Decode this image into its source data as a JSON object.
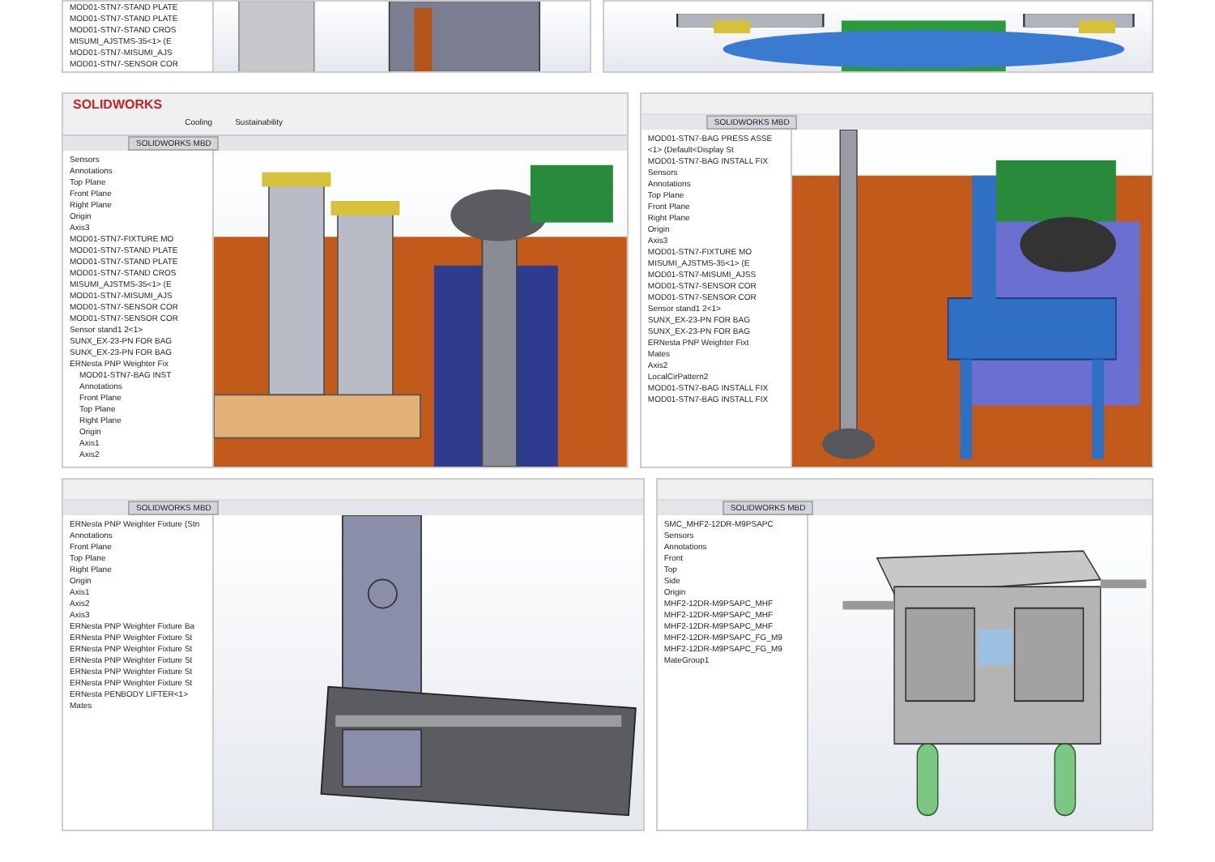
{
  "rows": [
    {
      "panels": [
        {
          "tree": [
            {
              "label": "MOD01-STN7-STAND PLATE"
            },
            {
              "label": "MOD01-STN7-STAND PLATE"
            },
            {
              "label": "MOD01-STN7-STAND CROS"
            },
            {
              "label": "MISUMI_AJSTMS-35<1> (E"
            },
            {
              "label": "MOD01-STN7-MISUMI_AJS"
            },
            {
              "label": "MOD01-STN7-SENSOR COR"
            }
          ],
          "viewport": {
            "kind": "gray"
          }
        },
        {
          "viewport": {
            "kind": "radial"
          }
        }
      ]
    },
    {
      "panels": [
        {
          "toolbar": {
            "logo": "SOLIDWORKS",
            "tools": [
              "Cooling",
              "Sustainability"
            ]
          },
          "tabs": [
            "SOLIDWORKS MBD"
          ],
          "tree": [
            {
              "label": "Sensors"
            },
            {
              "label": "Annotations"
            },
            {
              "label": "Top Plane"
            },
            {
              "label": "Front Plane"
            },
            {
              "label": "Right Plane"
            },
            {
              "label": "Origin"
            },
            {
              "label": "Axis3"
            },
            {
              "label": "MOD01-STN7-FIXTURE MO"
            },
            {
              "label": "MOD01-STN7-STAND PLATE"
            },
            {
              "label": "MOD01-STN7-STAND PLATE"
            },
            {
              "label": "MOD01-STN7-STAND CROS"
            },
            {
              "label": "MISUMI_AJSTMS-35<1> (E"
            },
            {
              "label": "MOD01-STN7-MISUMI_AJS"
            },
            {
              "label": "MOD01-STN7-SENSOR COR"
            },
            {
              "label": "MOD01-STN7-SENSOR COR"
            },
            {
              "label": "Sensor stand1 2<1>"
            },
            {
              "label": "SUNX_EX-23-PN FOR BAG"
            },
            {
              "label": "SUNX_EX-23-PN FOR BAG"
            },
            {
              "label": "ERNesta PNP Weighter Fix",
              "children": [
                {
                  "label": "MOD01-STN7-BAG INST"
                },
                {
                  "label": "Annotations"
                },
                {
                  "label": "Front Plane"
                },
                {
                  "label": "Top Plane"
                },
                {
                  "label": "Right Plane"
                },
                {
                  "label": "Origin"
                },
                {
                  "label": "Axis1"
                },
                {
                  "label": "Axis2"
                }
              ]
            }
          ],
          "viewport": {
            "kind": "orange"
          }
        },
        {
          "tabs": [
            "SOLIDWORKS MBD"
          ],
          "tree": [
            {
              "label": "MOD01-STN7-BAG PRESS ASSE"
            },
            {
              "label": "<1> (Default<Display St"
            },
            {
              "label": "MOD01-STN7-BAG INSTALL FIX"
            },
            {
              "label": "Sensors"
            },
            {
              "label": "Annotations"
            },
            {
              "label": "Top Plane"
            },
            {
              "label": "Front Plane"
            },
            {
              "label": "Right Plane"
            },
            {
              "label": "Origin"
            },
            {
              "label": "Axis3"
            },
            {
              "label": "MOD01-STN7-FIXTURE MO"
            },
            {
              "label": "MISUMI_AJSTMS-35<1> (E"
            },
            {
              "label": "MOD01-STN7-MISUMI_AJSS"
            },
            {
              "label": "MOD01-STN7-SENSOR COR"
            },
            {
              "label": "MOD01-STN7-SENSOR COR"
            },
            {
              "label": "Sensor stand1 2<1>"
            },
            {
              "label": "SUNX_EX-23-PN FOR BAG"
            },
            {
              "label": "SUNX_EX-23-PN FOR BAG"
            },
            {
              "label": "ERNesta PNP Weighter Fixt"
            },
            {
              "label": "Mates"
            },
            {
              "label": "Axis2"
            },
            {
              "label": "LocalCirPattern2"
            },
            {
              "label": "MOD01-STN7-BAG INSTALL FIX"
            },
            {
              "label": "MOD01-STN7-BAG INSTALL FIX"
            }
          ],
          "viewport": {
            "kind": "blue"
          }
        }
      ]
    },
    {
      "panels": [
        {
          "tabs": [
            "SOLIDWORKS MBD"
          ],
          "tree": [
            {
              "label": "ERNesta PNP Weighter Fixture (Stn"
            },
            {
              "label": "Annotations"
            },
            {
              "label": "Front Plane"
            },
            {
              "label": "Top Plane"
            },
            {
              "label": "Right Plane"
            },
            {
              "label": "Origin"
            },
            {
              "label": "Axis1"
            },
            {
              "label": "Axis2"
            },
            {
              "label": "Axis3"
            },
            {
              "label": "ERNesta PNP Weighter Fixture Ba"
            },
            {
              "label": "ERNesta PNP Weighter Fixture St"
            },
            {
              "label": "ERNesta PNP Weighter Fixture St"
            },
            {
              "label": "ERNesta PNP Weighter Fixture St"
            },
            {
              "label": "ERNesta PNP Weighter Fixture St"
            },
            {
              "label": "ERNesta PNP Weighter Fixture St"
            },
            {
              "label": "ERNesta PENBODY LIFTER<1>"
            },
            {
              "label": "Mates"
            }
          ],
          "viewport": {
            "kind": "frame"
          }
        },
        {
          "tabs": [
            "SOLIDWORKS MBD"
          ],
          "tree": [
            {
              "label": "SMC_MHF2-12DR-M9PSAPC"
            },
            {
              "label": "Sensors"
            },
            {
              "label": "Annotations"
            },
            {
              "label": "Front"
            },
            {
              "label": "Top"
            },
            {
              "label": "Side"
            },
            {
              "label": "Origin"
            },
            {
              "label": "MHF2-12DR-M9PSAPC_MHF"
            },
            {
              "label": "MHF2-12DR-M9PSAPC_MHF"
            },
            {
              "label": "MHF2-12DR-M9PSAPC_MHF"
            },
            {
              "label": "MHF2-12DR-M9PSAPC_FG_M9"
            },
            {
              "label": "MHF2-12DR-M9PSAPC_FG_M9"
            },
            {
              "label": "MateGroup1"
            }
          ],
          "viewport": {
            "kind": "gripper"
          }
        }
      ]
    }
  ]
}
